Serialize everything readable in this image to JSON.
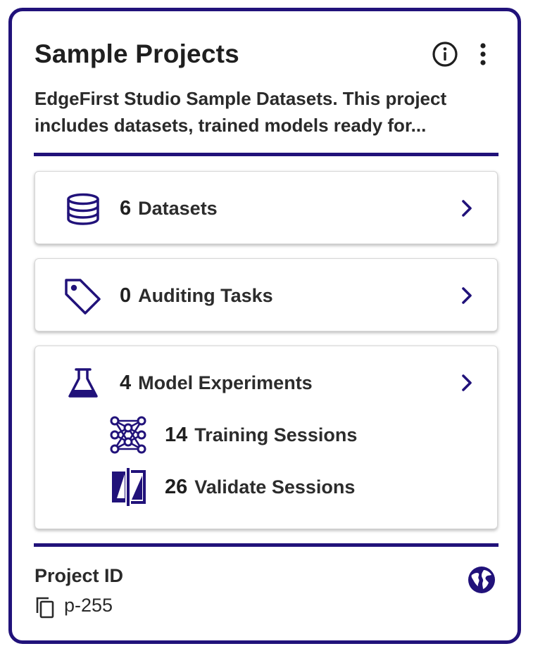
{
  "colors": {
    "accent": "#21127a",
    "text": "#1f1f1f"
  },
  "card": {
    "title": "Sample Projects",
    "description_lines": [
      "EdgeFirst Studio Sample Datasets. This project",
      "includes datasets, trained models ready for..."
    ],
    "header_icons": [
      "info-icon",
      "more-vertical-icon"
    ]
  },
  "stats": {
    "datasets": {
      "count": "6",
      "label": "Datasets",
      "icon": "database-icon"
    },
    "auditing": {
      "count": "0",
      "label": "Auditing Tasks",
      "icon": "tag-icon"
    },
    "experiments": {
      "count": "4",
      "label": "Model Experiments",
      "icon": "flask-icon"
    },
    "training": {
      "count": "14",
      "label": "Training Sessions",
      "icon": "neural-network-icon"
    },
    "validate": {
      "count": "26",
      "label": "Validate Sessions",
      "icon": "compare-icon"
    }
  },
  "footer": {
    "project_id_label": "Project ID",
    "project_id": "p-255",
    "icons": [
      "copy-icon",
      "globe-icon"
    ]
  }
}
